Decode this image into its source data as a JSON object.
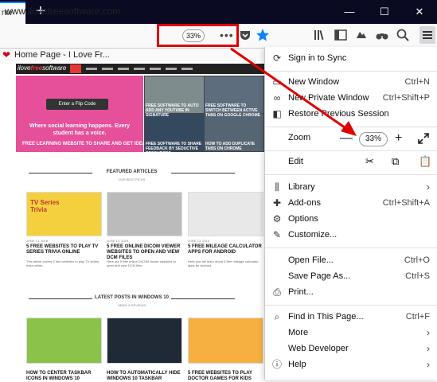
{
  "tab": {
    "title": "rtw"
  },
  "url": "www.ilovefreesoftware.com",
  "toolbar": {
    "zoom_chip": "33%",
    "page_actions": "•••"
  },
  "bookmark": {
    "title": "Home Page - I Love Fr..."
  },
  "site": {
    "logo": {
      "part1": "ilove",
      "part2": "free",
      "part3": "software"
    },
    "hero": {
      "flip_label": "Enter a Flip Code",
      "headline": "Where social learning happens. Every student has a voice.",
      "caption": "FREE LEARNING WEBSITE TO SHARE AND GET IDEAS USING VIDEOS"
    },
    "grid_captions": [
      "FREE SOFTWARE TO AUTO ADD ANY YOUTUBE IN SIGNATURE",
      "FREE SOFTWARE TO SWITCH BETWEEN ACTIVE TABS ON GOOGLE CHROME",
      "FREE SOFTWARE TO SHARE FEEDBACK BY SEDUCTIVE RESOURCES",
      "HOW TO ADD DUPLICATE TABS ON CHROME"
    ],
    "featured": {
      "title": "FEATURED ARTICLES",
      "subtitle": "OUR BEST PICKS"
    },
    "latest": {
      "title": "LATEST POSTS IN WINDOWS 10",
      "subtitle": "NEWS & REVIEWS"
    },
    "cards": [
      {
        "badge": "TV Series Trivia",
        "title": "5 FREE WEBSITES TO PLAY TV SERIES TRIVIA ONLINE",
        "meta": "JUNE 13, 2018",
        "text": "This article covers 5 free websites to play TV series trivia online."
      },
      {
        "title": "5 FREE ONLINE DICOM VIEWER WEBSITES TO OPEN AND VIEW DCM FILES",
        "meta": "JUNE 13, 2018",
        "text": "Here are 5 free online DICOM viewer websites to open and view DCM files."
      },
      {
        "title": "5 FREE MILEAGE CALCULATOR APPS FOR ANDROID",
        "meta": "JUNE 13, 2018",
        "text": "Here you will learn about 5 free mileage calculator apps for Android."
      }
    ],
    "bottom_cards": [
      {
        "title": "HOW TO CENTER TASKBAR ICONS IN WINDOWS 10"
      },
      {
        "title": "HOW TO AUTOMATICALLY HIDE WINDOWS 10 TASKBAR"
      },
      {
        "title": "5 FREE WEBSITES TO PLAY DOCTOR GAMES FOR KIDS"
      }
    ]
  },
  "menu": {
    "sign_in": "Sign in to Sync",
    "new_window": {
      "label": "New Window",
      "shortcut": "Ctrl+N"
    },
    "private_window": {
      "label": "New Private Window",
      "shortcut": "Ctrl+Shift+P"
    },
    "restore": {
      "label": "Restore Previous Session"
    },
    "zoom": {
      "label": "Zoom",
      "minus": "—",
      "value": "33%",
      "plus": "+"
    },
    "edit": {
      "label": "Edit"
    },
    "library": {
      "label": "Library"
    },
    "addons": {
      "label": "Add-ons",
      "shortcut": "Ctrl+Shift+A"
    },
    "options": {
      "label": "Options"
    },
    "customize": {
      "label": "Customize..."
    },
    "open_file": {
      "label": "Open File...",
      "shortcut": "Ctrl+O"
    },
    "save_page": {
      "label": "Save Page As...",
      "shortcut": "Ctrl+S"
    },
    "print": {
      "label": "Print..."
    },
    "find": {
      "label": "Find in This Page...",
      "shortcut": "Ctrl+F"
    },
    "more": {
      "label": "More"
    },
    "web_dev": {
      "label": "Web Developer"
    },
    "help": {
      "label": "Help"
    }
  },
  "colors": {
    "annotation": "#e00000",
    "accent": "#0a84ff",
    "site_red": "#e53935"
  }
}
